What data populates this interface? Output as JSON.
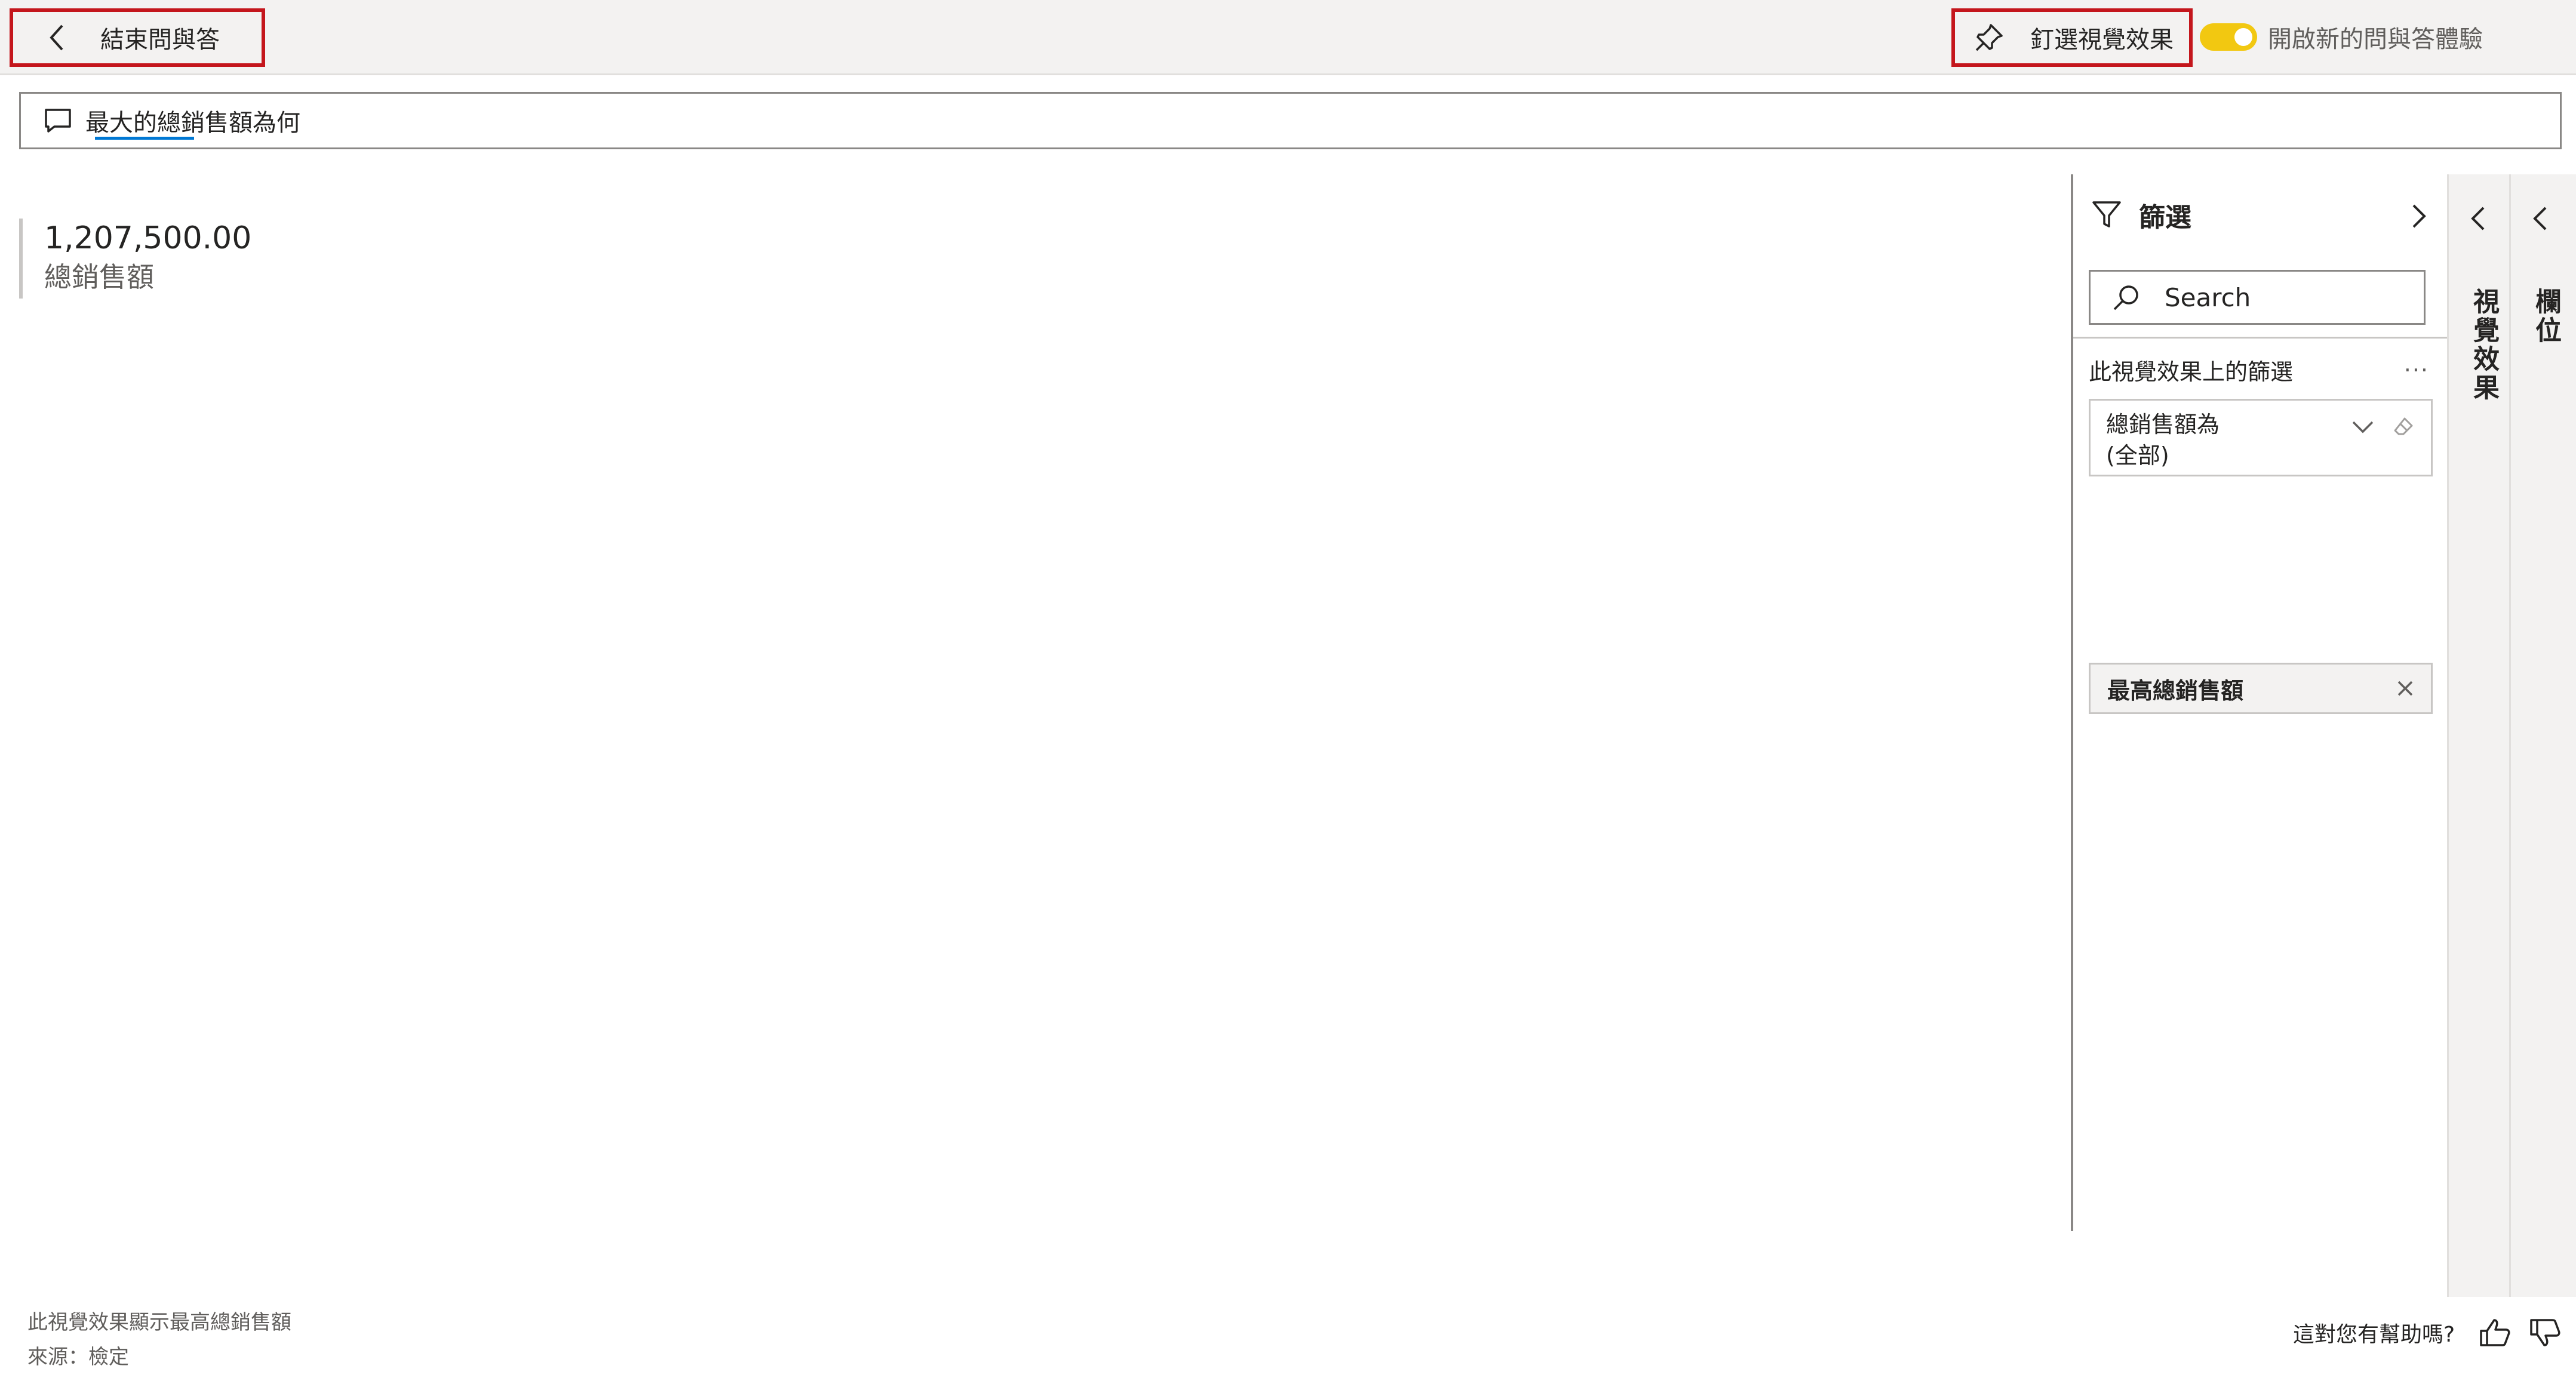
{
  "topbar": {
    "exit_label": "結束問與答",
    "pin_label": "釘選視覺效果",
    "toggle_label": "開啟新的問與答體驗",
    "toggle_on": true
  },
  "question": {
    "text": "最大的總銷售額為何"
  },
  "card": {
    "value": "1,207,500.00",
    "label": "總銷售額"
  },
  "filters_pane": {
    "title": "篩選",
    "search_placeholder": "Search",
    "section_title": "此視覺效果上的篩選",
    "more_label": "···",
    "filter_card": {
      "name": "總銷售額為",
      "value": "(全部)"
    },
    "filter_chip": {
      "name": "最高總銷售額"
    }
  },
  "side_tabs": {
    "visuals_label": "視覺效果",
    "fields_label": "欄位"
  },
  "footer": {
    "caption_line1": "此視覺效果顯示最高總銷售額",
    "caption_line2": "來源：檢定",
    "helpful_label": "這對您有幫助嗎?"
  },
  "colors": {
    "accent_underline": "#0078d4",
    "toggle_on": "#f2c811",
    "highlight_border": "#c4161c",
    "topbar_bg": "#f3f2f1"
  },
  "icons": {
    "back": "chevron-left-icon",
    "pin": "pin-icon",
    "question": "chat-bubble-icon",
    "filter": "funnel-icon",
    "search": "search-icon",
    "more": "more-dots-icon",
    "expand": "chevron-down-icon",
    "clear": "eraser-icon",
    "remove": "close-icon",
    "thumbs_up": "thumbs-up-icon",
    "thumbs_down": "thumbs-down-icon"
  }
}
